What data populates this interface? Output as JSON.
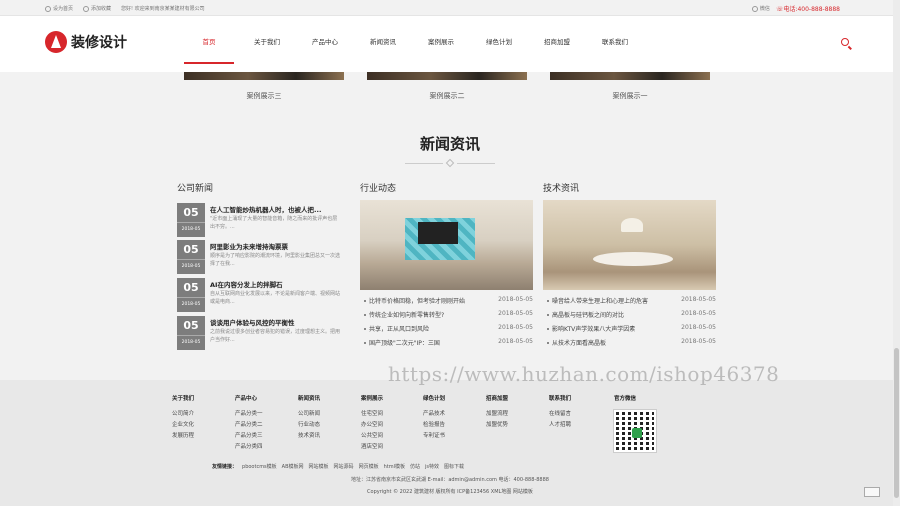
{
  "topbar": {
    "links": [
      "设为首页",
      "添加收藏",
      "您好! 欢迎来到南京某某建材有限公司"
    ],
    "wechat": "微信",
    "phone_label": "电话:",
    "phone": "400-888-8888"
  },
  "header": {
    "logo_text": "装修设计",
    "nav": [
      "首页",
      "关于我们",
      "产品中心",
      "新闻资讯",
      "案例展示",
      "绿色计划",
      "招商加盟",
      "联系我们"
    ],
    "active_index": 0
  },
  "cases": [
    "案例展示三",
    "案例展示二",
    "案例展示一"
  ],
  "news_section": {
    "title": "新闻资讯",
    "company": {
      "title": "公司新闻",
      "items": [
        {
          "day": "05",
          "ym": "2018-05",
          "title": "在人工智能炒热机器人时，也被人把...",
          "summary": "\"近市面上涌现了大量的智能音箱，随之而来的批评声也层出不穷。..."
        },
        {
          "day": "05",
          "ym": "2018-05",
          "title": "阿里影业为未来增持淘票票",
          "summary": "顺序是为了响应影院的潮流环境，阿里影业集团总又一次选择了在我..."
        },
        {
          "day": "05",
          "ym": "2018-05",
          "title": "AI在内容分发上的拌脚石",
          "summary": "自从互联网商业化发展以来，不论是新闻客户端、视频网站或是电商..."
        },
        {
          "day": "05",
          "ym": "2018-05",
          "title": "谈谈用户体验与风控的平衡性",
          "summary": "之前我说过很多创业者容易犯的错误，过度理想主义。把用户当作好..."
        }
      ]
    },
    "industry": {
      "title": "行业动态",
      "items": [
        {
          "title": "比特币价格回稳，但考验才刚刚开始",
          "date": "2018-05-05"
        },
        {
          "title": "传统企业如何向新零售转型?",
          "date": "2018-05-05"
        },
        {
          "title": "共享，正从风口到风险",
          "date": "2018-05-05"
        },
        {
          "title": "国产顶级\"二次元\"IP：三国",
          "date": "2018-05-05"
        }
      ]
    },
    "tech": {
      "title": "技术资讯",
      "items": [
        {
          "title": "噪音给人带来生理上和心理上的危害",
          "date": "2018-05-05"
        },
        {
          "title": "高晶板与硅钙板之间的对比",
          "date": "2018-05-05"
        },
        {
          "title": "影响KTV声学效果八大声学因素",
          "date": "2018-05-05"
        },
        {
          "title": "从技术方面看高晶板",
          "date": "2018-05-05"
        }
      ]
    }
  },
  "footer": {
    "columns": [
      {
        "title": "关于我们",
        "links": [
          "公司简介",
          "企业文化",
          "发展历程"
        ]
      },
      {
        "title": "产品中心",
        "links": [
          "产品分类一",
          "产品分类二",
          "产品分类三",
          "产品分类四"
        ]
      },
      {
        "title": "新闻资讯",
        "links": [
          "公司新闻",
          "行业动态",
          "技术资讯"
        ]
      },
      {
        "title": "案例展示",
        "links": [
          "住宅空间",
          "办公空间",
          "公共空间",
          "酒店空间"
        ]
      },
      {
        "title": "绿色计划",
        "links": [
          "产品技术",
          "检验报告",
          "专利证书"
        ]
      },
      {
        "title": "招商加盟",
        "links": [
          "加盟流程",
          "加盟优势"
        ]
      },
      {
        "title": "联系我们",
        "links": [
          "在线留言",
          "人才招聘"
        ]
      },
      {
        "title": "官方微信",
        "links": []
      }
    ],
    "friend_label": "友情链接：",
    "friend_links": [
      "pbootcms模板",
      "AB模板网",
      "网站模板",
      "网站源码",
      "网页模板",
      "html模板",
      "仿站",
      "js特效",
      "图标下载"
    ],
    "address": "地址：江苏省南京市玄武区玄武湖  E-mail：admin@admin.com  电话：400-888-8888",
    "copyright": "Copyright © 2022 建筑建材 版权所有 ICP备123456 XML地图 网站模板"
  },
  "watermark": "https://www.huzhan.com/ishop46378"
}
